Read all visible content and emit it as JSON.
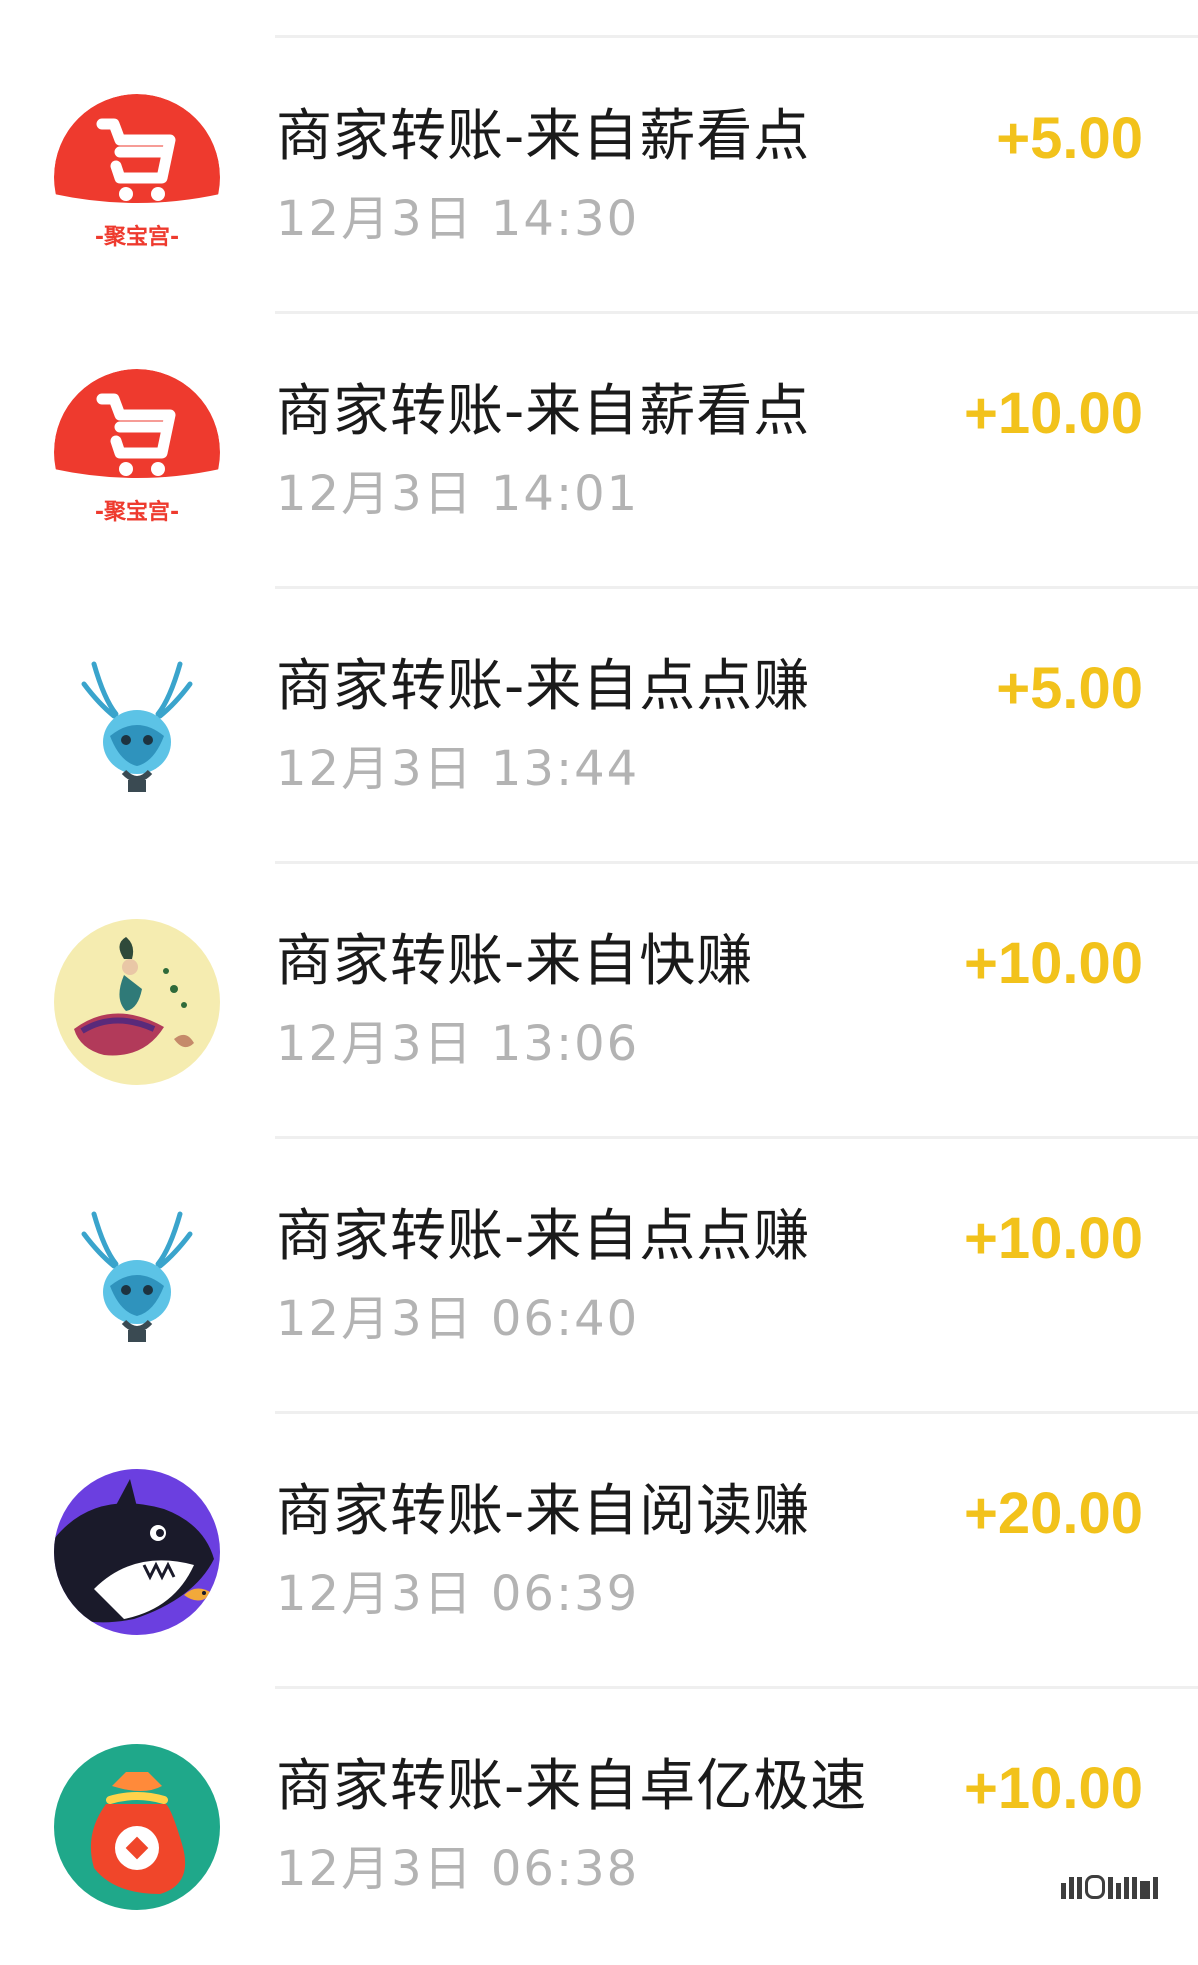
{
  "colors": {
    "amount": "#f2c21b",
    "title": "#1a1a1a",
    "time": "#b3b3b3",
    "divider": "#efefef"
  },
  "transactions": [
    {
      "title": "商家转账-来自薪看点",
      "time": "12月3日 14:30",
      "amount": "+5.00",
      "icon": "jubaogong-cart-icon",
      "logo_text": "-聚宝宫-"
    },
    {
      "title": "商家转账-来自薪看点",
      "time": "12月3日 14:01",
      "amount": "+10.00",
      "icon": "jubaogong-cart-icon",
      "logo_text": "-聚宝宫-"
    },
    {
      "title": "商家转账-来自点点赚",
      "time": "12月3日 13:44",
      "amount": "+5.00",
      "icon": "blue-dragon-icon"
    },
    {
      "title": "商家转账-来自快赚",
      "time": "12月3日 13:06",
      "amount": "+10.00",
      "icon": "dancer-illustration-icon"
    },
    {
      "title": "商家转账-来自点点赚",
      "time": "12月3日 06:40",
      "amount": "+10.00",
      "icon": "blue-dragon-icon"
    },
    {
      "title": "商家转账-来自阅读赚",
      "time": "12月3日 06:39",
      "amount": "+20.00",
      "icon": "shark-icon"
    },
    {
      "title": "商家转账-来自卓亿极速",
      "time": "12月3日 06:38",
      "amount": "+10.00",
      "icon": "money-bag-icon"
    }
  ]
}
